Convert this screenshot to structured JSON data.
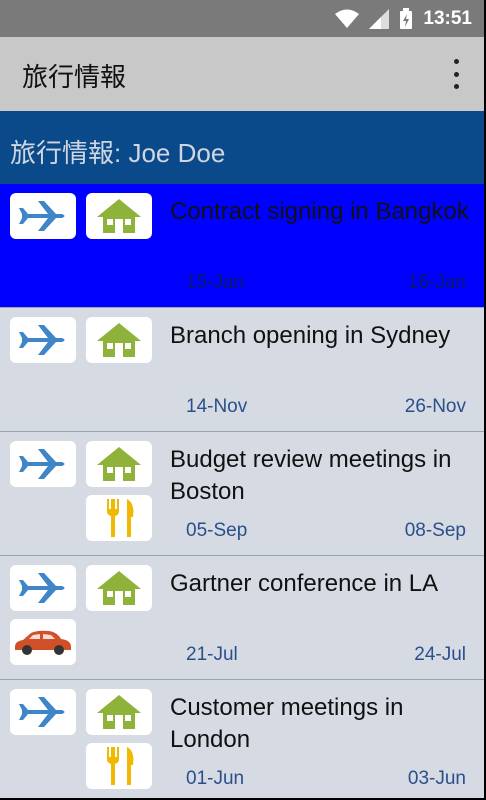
{
  "status": {
    "time": "13:51"
  },
  "appbar": {
    "title": "旅行情報"
  },
  "header": {
    "text": "旅行情報: Joe Doe"
  },
  "trips": [
    {
      "title": "Contract signing in Bangkok",
      "start": "15-Jan",
      "end": "16-Jan",
      "icons": [
        "plane-icon",
        "home-icon"
      ],
      "selected": true
    },
    {
      "title": "Branch opening in Sydney",
      "start": "14-Nov",
      "end": "26-Nov",
      "icons": [
        "plane-icon",
        "home-icon"
      ],
      "selected": false
    },
    {
      "title": "Budget review meetings in Boston",
      "start": "05-Sep",
      "end": "08-Sep",
      "icons": [
        "plane-icon",
        "home-icon",
        "fork-knife-icon"
      ],
      "selected": false
    },
    {
      "title": "Gartner conference in LA",
      "start": "21-Jul",
      "end": "24-Jul",
      "icons": [
        "plane-icon",
        "home-icon",
        "car-icon"
      ],
      "selected": false
    },
    {
      "title": "Customer meetings in London",
      "start": "01-Jun",
      "end": "03-Jun",
      "icons": [
        "plane-icon",
        "home-icon",
        "fork-knife-icon"
      ],
      "selected": false
    }
  ],
  "colors": {
    "plane": "#3f86c8",
    "home": "#8fb33a",
    "food": "#f0b800",
    "car": "#d0502a",
    "selected_bg": "#0000ff",
    "header_bg": "#0b4a8a"
  }
}
